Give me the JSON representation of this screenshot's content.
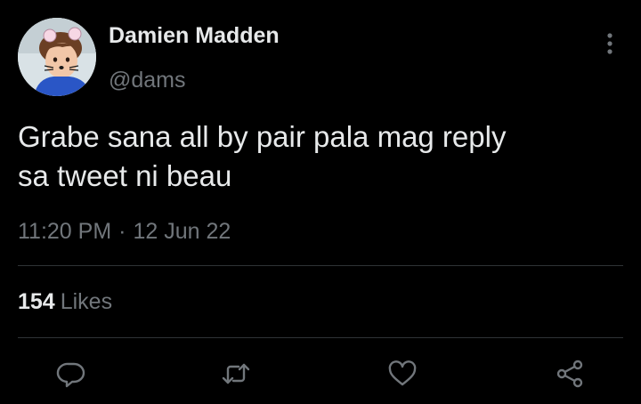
{
  "tweet": {
    "author": {
      "name": "Damien Madden",
      "handle": "@dams"
    },
    "text_lines": [
      "Grabe sana all by pair pala mag reply",
      "sa tweet ni beau"
    ],
    "time": "11:20 PM",
    "separator": "·",
    "date": "12 Jun 22",
    "likes": {
      "count": "154",
      "label": "Likes"
    }
  },
  "actions": [
    {
      "name": "reply",
      "icon": "reply-icon"
    },
    {
      "name": "retweet",
      "icon": "retweet-icon"
    },
    {
      "name": "like",
      "icon": "heart-icon"
    },
    {
      "name": "share",
      "icon": "share-icon"
    }
  ],
  "colors": {
    "background": "#000000",
    "text_primary": "#e7e9ea",
    "text_secondary": "#71767b",
    "divider": "#2f3336"
  }
}
